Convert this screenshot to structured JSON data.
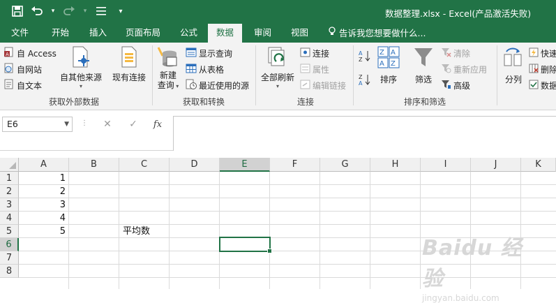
{
  "window": {
    "title": "数据整理.xlsx - Excel(产品激活失败)"
  },
  "quick_access": {
    "customize_glyph": "▾"
  },
  "tabs": [
    "文件",
    "开始",
    "插入",
    "页面布局",
    "公式",
    "数据",
    "审阅",
    "视图"
  ],
  "active_tab": "数据",
  "tell_me": "告诉我您想要做什么...",
  "ribbon": {
    "get_external": {
      "label": "获取外部数据",
      "access": "自 Access",
      "web": "自网站",
      "text": "自文本",
      "other_sources": "自其他来源",
      "existing_connections": "现有连接"
    },
    "get_transform": {
      "label": "获取和转换",
      "new_query_line1": "新建",
      "new_query_line2": "查询",
      "show_queries": "显示查询",
      "from_table": "从表格",
      "recent_sources": "最近使用的源"
    },
    "connections": {
      "label": "连接",
      "refresh_all": "全部刷新",
      "connections": "连接",
      "properties": "属性",
      "edit_links": "编辑链接"
    },
    "sort_filter": {
      "label": "排序和筛选",
      "sort": "排序",
      "filter": "筛选",
      "clear": "清除",
      "reapply": "重新应用",
      "advanced": "高级"
    },
    "data_tools": {
      "text_to_columns": "分列",
      "flash_fill": "快速",
      "remove_duplicates": "删除",
      "data_validation": "数据"
    }
  },
  "formula_bar": {
    "name_box": "E6",
    "fx": "fx",
    "value": ""
  },
  "columns": [
    "A",
    "B",
    "C",
    "D",
    "E",
    "F",
    "G",
    "H",
    "I",
    "J",
    "K"
  ],
  "rows": [
    "1",
    "2",
    "3",
    "4",
    "5",
    "6",
    "7",
    "8"
  ],
  "cells": {
    "A1": "1",
    "A2": "2",
    "A3": "3",
    "A4": "4",
    "A5": "5",
    "C5": "平均数"
  },
  "selected_cell": "E6",
  "watermark": {
    "brand": "Baidu 经验",
    "url": "jingyan.baidu.com"
  },
  "colors": {
    "accent": "#217346",
    "ribbon_bg": "#f3f3f3",
    "grid_line": "#dadada"
  }
}
